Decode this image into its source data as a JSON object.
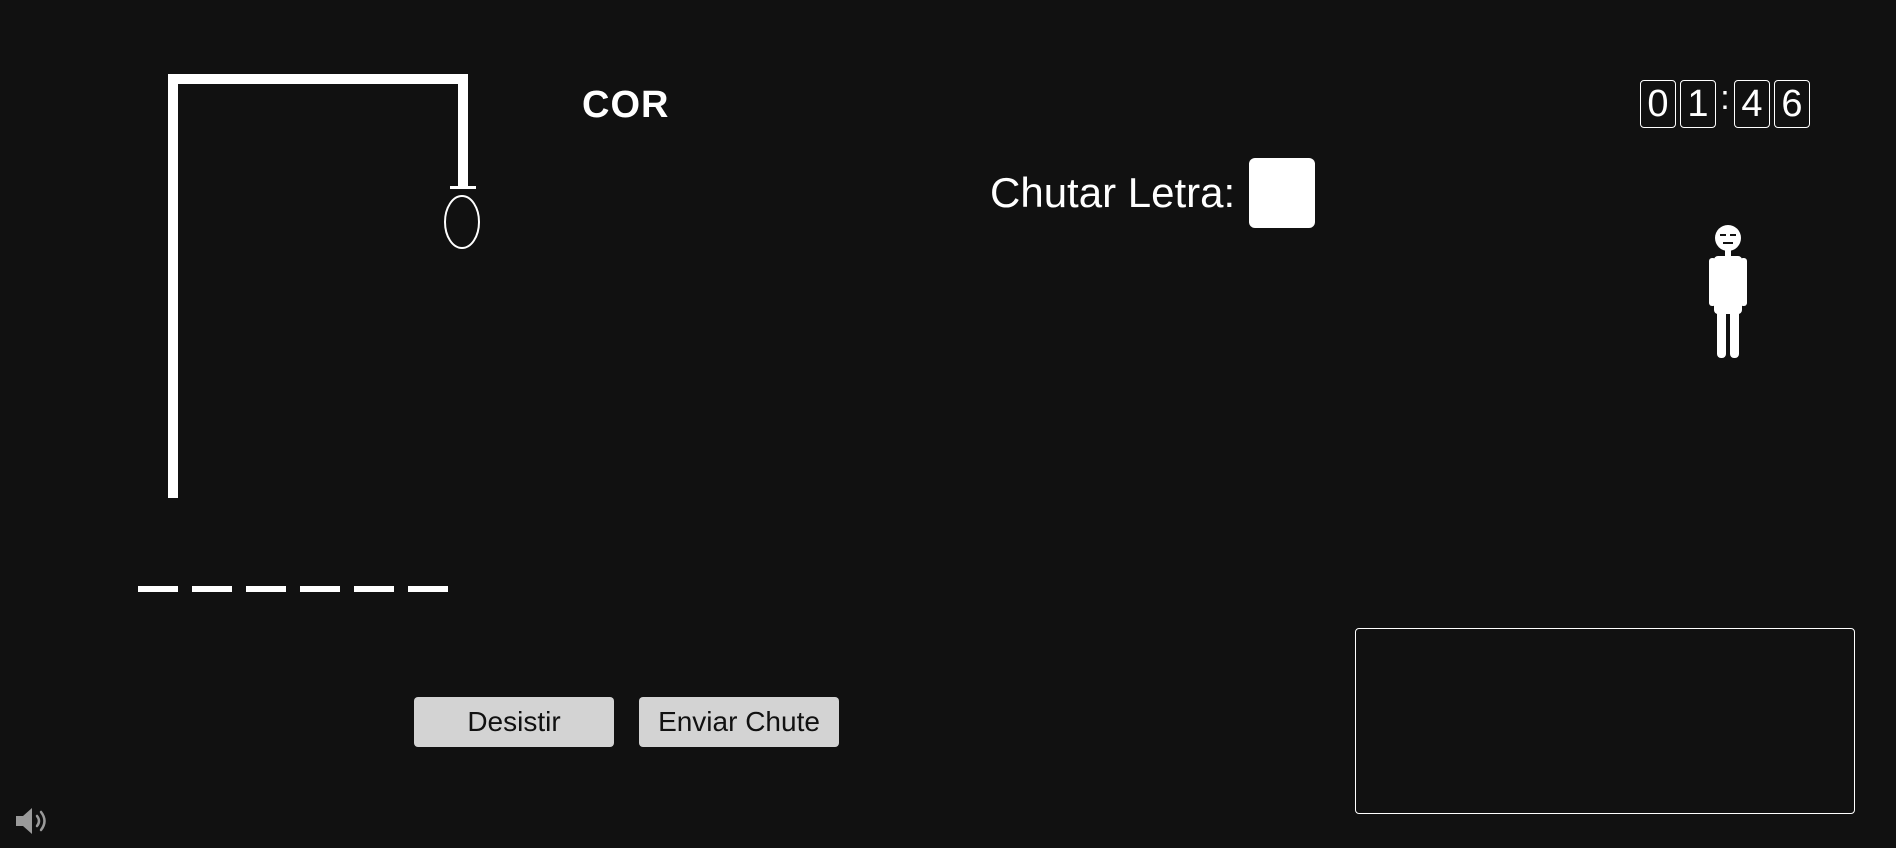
{
  "game": {
    "category": "COR",
    "word_length": 6
  },
  "guess": {
    "label": "Chutar Letra:",
    "value": ""
  },
  "timer": {
    "d1": "0",
    "d2": "1",
    "separator": ":",
    "d3": "4",
    "d4": "6"
  },
  "buttons": {
    "give_up": "Desistir",
    "send_guess": "Enviar Chute"
  },
  "icons": {
    "sound": "speaker-volume-icon"
  },
  "colors": {
    "background": "#111111",
    "foreground": "#ffffff",
    "button": "#d3d3d3"
  }
}
